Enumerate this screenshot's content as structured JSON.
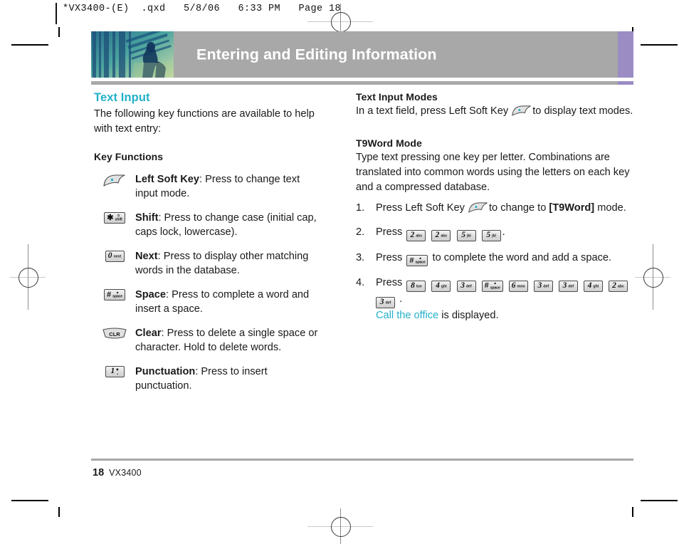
{
  "slug": {
    "text": "*VX3400-(E)  .qxd   5/8/06   6:33 PM   Page 18"
  },
  "banner": {
    "title": "Entering and Editing Information",
    "bg_color": "#a8a8a8",
    "accent_color": "#9b8cc4",
    "title_color": "#ffffff"
  },
  "colors": {
    "teal": "#22b0c8",
    "gray_rule": "#a8a8a8",
    "purple": "#9b8cc4"
  },
  "left_column": {
    "section_title": "Text Input",
    "intro": "The following key functions are available to help with text entry:",
    "sub_title": "Key Functions",
    "key_functions": [
      {
        "icon": "left-soft-key",
        "term": "Left Soft Key",
        "description": ": Press to change text input mode."
      },
      {
        "icon": "star-shift-key",
        "key_digit": "✱",
        "key_sub_top": "✲",
        "key_sub_bot": "shift",
        "term": "Shift",
        "description": ": Press to change case (initial cap, caps lock, lowercase)."
      },
      {
        "icon": "zero-next-key",
        "key_digit": "0",
        "key_sub_bot": "next",
        "term": "Next",
        "description": ": Press to display other matching words in the database."
      },
      {
        "icon": "pound-space-key",
        "key_digit": "#",
        "key_sub_top": "●",
        "key_sub_bot": "space",
        "term": "Space",
        "description": ": Press to complete a word and insert a space."
      },
      {
        "icon": "clear-key",
        "key_label": "CLR",
        "term": "Clear",
        "description": ": Press to delete a single space or character. Hold to delete words."
      },
      {
        "icon": "one-punctuation-key",
        "key_digit": "1",
        "key_sub_bot": ".,",
        "term": "Punctuation",
        "description": ": Press to insert punctuation."
      }
    ]
  },
  "right_column": {
    "modes_title": "Text Input Modes",
    "modes_text_before": "In a text field, press Left Soft Key",
    "modes_text_after": "to display text modes.",
    "t9_title": "T9Word Mode",
    "t9_text": "Type text pressing one key per letter. Combinations are translated into common words using the letters on each key and a compressed database.",
    "steps": [
      {
        "num": "1.",
        "text_before": "Press Left Soft Key",
        "text_mid": "to change to",
        "bold_label": "[T9Word]",
        "text_after": "mode."
      },
      {
        "num": "2.",
        "text_before": "Press",
        "keys": [
          {
            "digit": "2",
            "sub": "abc"
          },
          {
            "digit": "2",
            "sub": "abc"
          },
          {
            "digit": "5",
            "sub": "jkl"
          },
          {
            "digit": "5",
            "sub": "jkl"
          }
        ],
        "text_after": "."
      },
      {
        "num": "3.",
        "text_before": "Press",
        "keys": [
          {
            "digit": "#",
            "sub": "space",
            "sub_top": "●"
          }
        ],
        "text_after": "to complete the word and add a space."
      },
      {
        "num": "4.",
        "text_before": "Press",
        "keys": [
          {
            "digit": "8",
            "sub": "tuv"
          },
          {
            "digit": "4",
            "sub": "ghi"
          },
          {
            "digit": "3",
            "sub": "def"
          },
          {
            "digit": "#",
            "sub": "space",
            "sub_top": "●"
          },
          {
            "digit": "6",
            "sub": "mno"
          },
          {
            "digit": "3",
            "sub": "def"
          },
          {
            "digit": "3",
            "sub": "def"
          },
          {
            "digit": "4",
            "sub": "ghi"
          },
          {
            "digit": "2",
            "sub": "abc"
          }
        ],
        "keys_line2": [
          {
            "digit": "3",
            "sub": "def"
          }
        ],
        "text_after": ".",
        "result_teal": "Call the office",
        "result_rest": "is displayed."
      }
    ]
  },
  "footer": {
    "page_number": "18",
    "model": "VX3400"
  }
}
